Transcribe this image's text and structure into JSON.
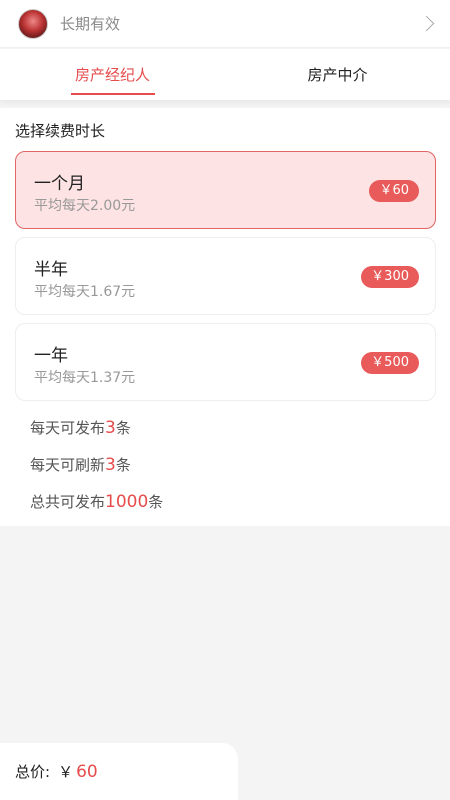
{
  "header": {
    "status_text": "长期有效"
  },
  "tabs": [
    {
      "label": "房产经纪人",
      "active": true
    },
    {
      "label": "房产中介",
      "active": false
    }
  ],
  "section_title": "选择续费时长",
  "plans": [
    {
      "name": "一个月",
      "avg": "平均每天2.00元",
      "price": "￥60",
      "selected": true
    },
    {
      "name": "半年",
      "avg": "平均每天1.67元",
      "price": "￥300",
      "selected": false
    },
    {
      "name": "一年",
      "avg": "平均每天1.37元",
      "price": "￥500",
      "selected": false
    }
  ],
  "perks": [
    {
      "prefix": "每天可发布",
      "value": "3",
      "suffix": "条"
    },
    {
      "prefix": "每天可刷新",
      "value": "3",
      "suffix": "条"
    },
    {
      "prefix": "总共可发布",
      "value": "1000",
      "suffix": "条"
    }
  ],
  "footer": {
    "total_label": "总价:",
    "currency": "￥",
    "total_value": "60"
  },
  "colors": {
    "accent": "#e64c4c",
    "badge": "#e95a5a",
    "selected_bg": "#fde3e3"
  },
  "icons": {
    "avatar": "user-avatar",
    "chevron": "chevron-right-icon"
  }
}
